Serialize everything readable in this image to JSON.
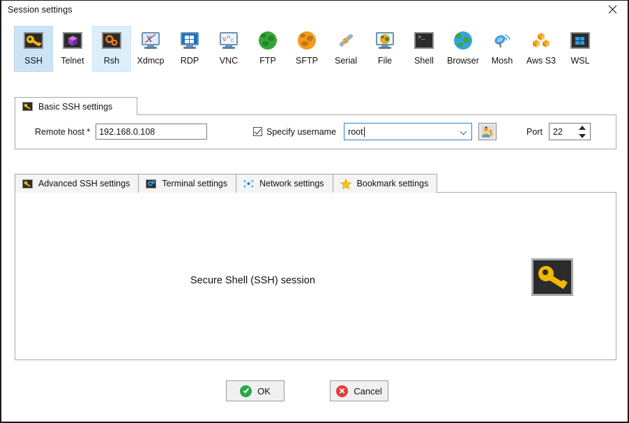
{
  "window": {
    "title": "Session settings",
    "close_label": "×"
  },
  "protocols": [
    {
      "label": "SSH",
      "icon": "ssh-key-icon",
      "state": "selected"
    },
    {
      "label": "Telnet",
      "icon": "telnet-icon",
      "state": "normal"
    },
    {
      "label": "Rsh",
      "icon": "rsh-gears-icon",
      "state": "hovered"
    },
    {
      "label": "Xdmcp",
      "icon": "xdmcp-icon",
      "state": "normal"
    },
    {
      "label": "RDP",
      "icon": "rdp-windows-icon",
      "state": "normal"
    },
    {
      "label": "VNC",
      "icon": "vnc-icon",
      "state": "normal"
    },
    {
      "label": "FTP",
      "icon": "ftp-globe-icon",
      "state": "normal"
    },
    {
      "label": "SFTP",
      "icon": "sftp-globe-icon",
      "state": "normal"
    },
    {
      "label": "Serial",
      "icon": "serial-plug-icon",
      "state": "normal"
    },
    {
      "label": "File",
      "icon": "file-monitor-icon",
      "state": "normal"
    },
    {
      "label": "Shell",
      "icon": "shell-prompt-icon",
      "state": "normal"
    },
    {
      "label": "Browser",
      "icon": "browser-globe-icon",
      "state": "normal"
    },
    {
      "label": "Mosh",
      "icon": "mosh-dish-icon",
      "state": "normal"
    },
    {
      "label": "Aws S3",
      "icon": "aws-s3-icon",
      "state": "normal"
    },
    {
      "label": "WSL",
      "icon": "wsl-windows-icon",
      "state": "normal"
    }
  ],
  "basic_panel": {
    "tab_label": "Basic SSH settings",
    "tab_icon": "ssh-key-icon",
    "remote_host_label": "Remote host *",
    "remote_host_value": "192.168.0.108",
    "specify_username_label": "Specify username",
    "specify_username_checked": true,
    "username_value": "root",
    "user_button_icon": "user-key-icon",
    "port_label": "Port",
    "port_value": "22"
  },
  "lower_tabs": [
    {
      "label": "Advanced SSH settings",
      "icon": "ssh-key-icon"
    },
    {
      "label": "Terminal settings",
      "icon": "terminal-gear-icon"
    },
    {
      "label": "Network settings",
      "icon": "network-nodes-icon"
    },
    {
      "label": "Bookmark settings",
      "icon": "star-icon"
    }
  ],
  "content": {
    "description": "Secure Shell (SSH) session",
    "icon": "ssh-key-large-icon"
  },
  "footer": {
    "ok_label": "OK",
    "cancel_label": "Cancel",
    "ok_icon": "check-circle-icon",
    "cancel_icon": "cancel-circle-icon"
  },
  "colors": {
    "selected_tile": "#cce3f6",
    "hovered_tile": "#ddeefb",
    "focus_border": "#2a7fd4",
    "key_yellow": "#f2b705",
    "ok_green": "#27a844",
    "cancel_red": "#e23b3b"
  }
}
